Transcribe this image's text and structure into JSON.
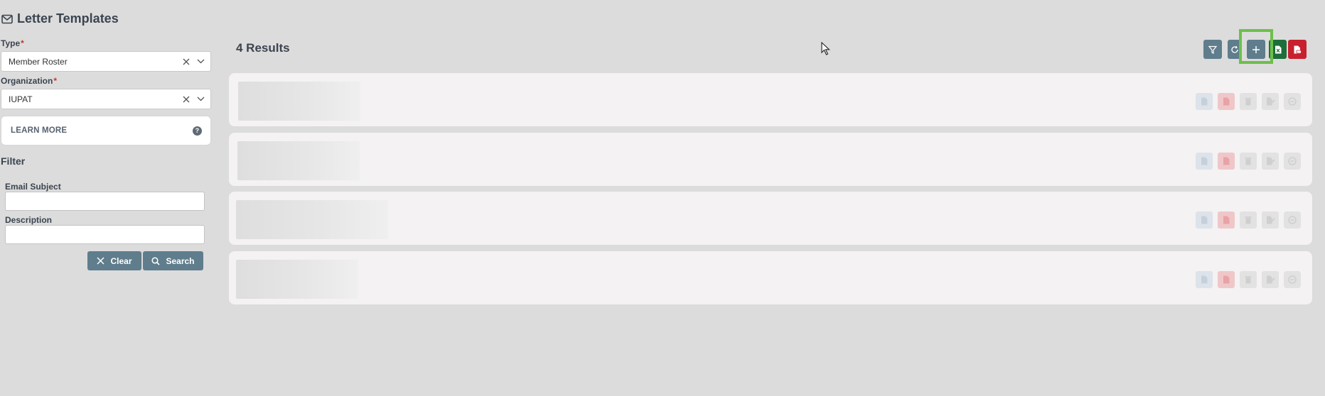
{
  "page": {
    "title": "Letter Templates"
  },
  "form": {
    "type_label": "Type",
    "type_value": "Member Roster",
    "org_label": "Organization",
    "org_value": "IUPAT",
    "required_mark": "*",
    "learn_more": "LEARN MORE",
    "help_glyph": "?"
  },
  "filter": {
    "title": "Filter",
    "email_subject_label": "Email Subject",
    "email_subject_value": "",
    "description_label": "Description",
    "description_value": "",
    "clear_label": "Clear",
    "search_label": "Search"
  },
  "results": {
    "count_label": "4 Results",
    "rows": [
      {},
      {},
      {},
      {}
    ]
  },
  "toolbar": {
    "icons": [
      "filter-icon",
      "refresh-icon",
      "add-icon",
      "excel-export-icon",
      "pdf-export-icon"
    ]
  },
  "colors": {
    "toolbar_gray": "#5f7d8c",
    "excel_green": "#1e6e3a",
    "pdf_red": "#c8202e",
    "highlight": "#6cc04a"
  }
}
